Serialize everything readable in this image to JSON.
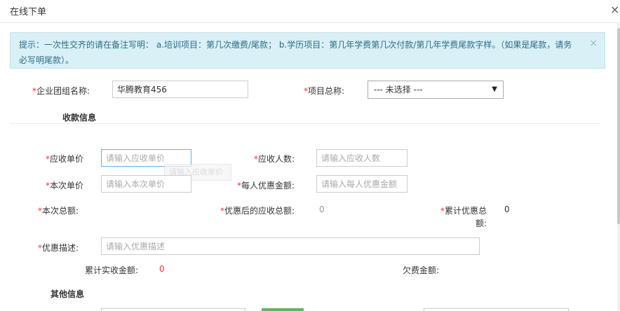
{
  "dialog": {
    "title": "在线下单",
    "close_icon": "×"
  },
  "alert": {
    "text": "提示：一次性交齐的请在备注写明： a.培训项目：第几次缴费/尾款； b.学历项目：第几年学费第几次付款/第几年学费尾款字样。（如果是尾款，请务必写明尾款）。",
    "close_icon": "×"
  },
  "form": {
    "required_mark": "*",
    "company_label": "企业团组名称:",
    "company_value": "华腾教育456",
    "project_label": "项目总称:",
    "project_selected": "--- 未选择 ---",
    "project_arrow": "▼"
  },
  "collection": {
    "section_title": "收款信息",
    "unit_price_label": "应收单价",
    "unit_price_placeholder": "请输入应收单价",
    "people_label": "应收人数:",
    "people_placeholder": "请输入应收人数",
    "current_price_label": "本次单价",
    "current_price_placeholder": "请输入本次单价",
    "discount_per_label": "每人优惠金额:",
    "discount_per_placeholder": "请输入每人优惠金额",
    "current_total_label": "本次总额:",
    "after_discount_label": "优惠后的应收总额:",
    "after_discount_value": "0",
    "cum_discount_label_1": "累计优惠总",
    "cum_discount_label_2": "额:",
    "cum_discount_value": "0",
    "discount_desc_label": "优惠描述:",
    "discount_desc_placeholder": "请输入优惠描述",
    "cum_received_label": "累计实收金额:",
    "cum_received_value": "0",
    "arrears_label": "欠费金额:",
    "tooltip_text": "请输入应收单价"
  },
  "other": {
    "section_title": "其他信息"
  }
}
